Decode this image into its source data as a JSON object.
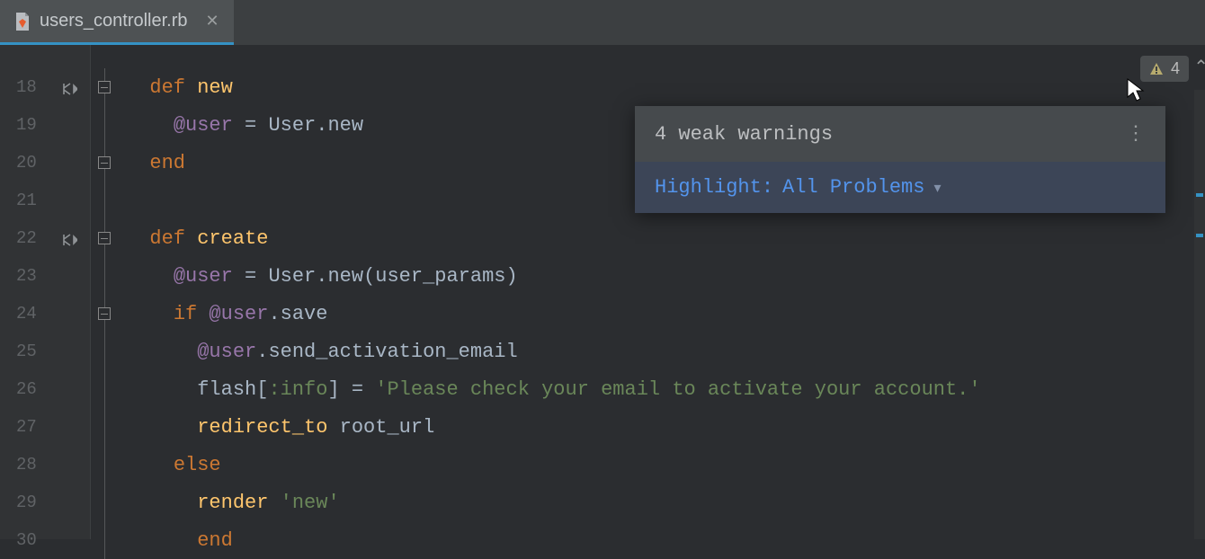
{
  "tab": {
    "filename": "users_controller.rb"
  },
  "inspection": {
    "count": "4",
    "popup_title": "4 weak warnings",
    "highlight_label": "Highlight:",
    "highlight_value": "All Problems"
  },
  "gutter": {
    "lines": [
      "18",
      "19",
      "20",
      "21",
      "22",
      "23",
      "24",
      "25",
      "26",
      "27",
      "28",
      "29",
      "30"
    ]
  },
  "code": {
    "l18": {
      "kw": "def ",
      "name": "new"
    },
    "l19": {
      "ivar": "@user",
      "op": " = ",
      "const": "User",
      "dot": ".",
      "call": "new"
    },
    "l20": {
      "kw": "end"
    },
    "l21": {
      "blank": ""
    },
    "l22": {
      "kw": "def ",
      "name": "create"
    },
    "l23": {
      "ivar": "@user",
      "op": " = ",
      "const": "User",
      "dot": ".",
      "call": "new",
      "lp": "(",
      "arg": "user_params",
      "rp": ")"
    },
    "l24": {
      "kw": "if ",
      "ivar": "@user",
      "dot": ".",
      "call": "save"
    },
    "l25": {
      "ivar": "@user",
      "dot": ".",
      "call": "send_activation_email"
    },
    "l26": {
      "ident": "flash",
      "lb": "[",
      "sym": ":info",
      "rb": "]",
      "op": " = ",
      "str": "'Please check your email to activate your account.'"
    },
    "l27": {
      "ident": "redirect_to ",
      "arg": "root_url"
    },
    "l28": {
      "kw": "else"
    },
    "l29": {
      "ident": "render ",
      "str": "'new'"
    },
    "l30": {
      "kw": "end"
    }
  }
}
